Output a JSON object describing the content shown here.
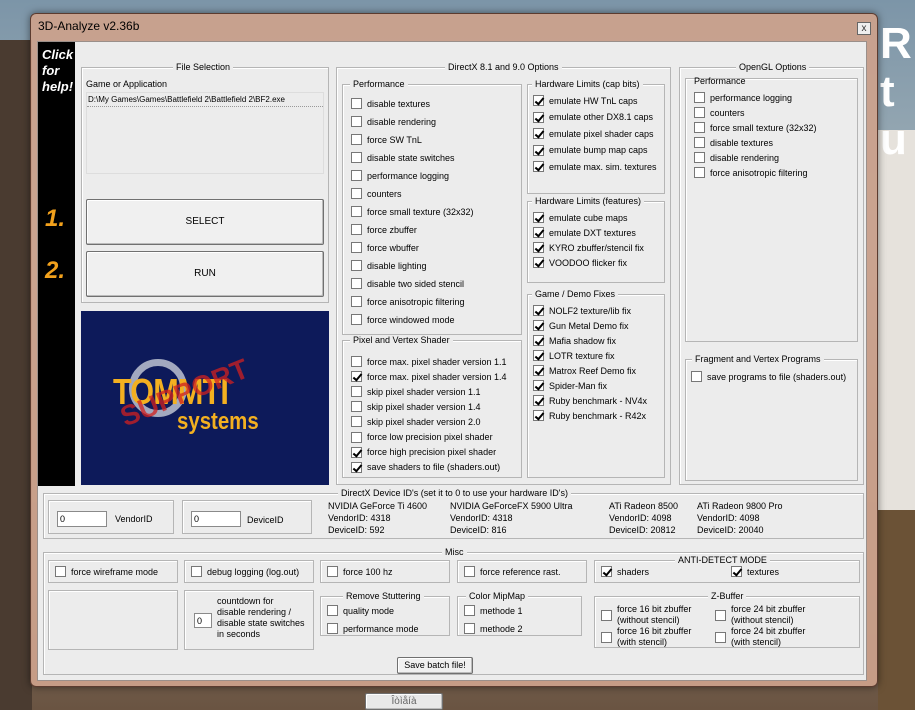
{
  "window": {
    "title": "3D-Analyze v2.36b",
    "close_glyph": "x"
  },
  "sidebar": {
    "help_lines": [
      "Click",
      "for",
      "help!"
    ],
    "step1": "1.",
    "step2": "2."
  },
  "file_selection": {
    "title": "File Selection",
    "label": "Game or Application",
    "path": "D:\\My Games\\Games\\Battlefield 2\\Battlefield 2\\BF2.exe",
    "select_label": "SELECT",
    "run_label": "RUN"
  },
  "logo": {
    "text_main": "TOMMTI",
    "text_sub": "systems",
    "stamp": "SUPPORT"
  },
  "directx": {
    "title": "DirectX 8.1 and 9.0 Options",
    "performance": {
      "title": "Performance",
      "items": [
        {
          "label": "disable textures",
          "checked": false
        },
        {
          "label": "disable rendering",
          "checked": false
        },
        {
          "label": "force SW TnL",
          "checked": false
        },
        {
          "label": "disable state switches",
          "checked": false
        },
        {
          "label": "performance logging",
          "checked": false
        },
        {
          "label": "counters",
          "checked": false
        },
        {
          "label": "force small texture (32x32)",
          "checked": false
        },
        {
          "label": "force zbuffer",
          "checked": false
        },
        {
          "label": "force wbuffer",
          "checked": false
        },
        {
          "label": "disable lighting",
          "checked": false
        },
        {
          "label": "disable two sided stencil",
          "checked": false
        },
        {
          "label": "force anisotropic filtering",
          "checked": false
        },
        {
          "label": "force windowed mode",
          "checked": false
        }
      ]
    },
    "shader": {
      "title": "Pixel and Vertex Shader",
      "items": [
        {
          "label": "force max. pixel shader version 1.1",
          "checked": false
        },
        {
          "label": "force max. pixel shader version 1.4",
          "checked": true
        },
        {
          "label": "skip pixel shader version 1.1",
          "checked": false
        },
        {
          "label": "skip pixel shader version 1.4",
          "checked": false
        },
        {
          "label": "skip pixel shader version 2.0",
          "checked": false
        },
        {
          "label": "force low precision pixel shader",
          "checked": false
        },
        {
          "label": "force high precision pixel shader",
          "checked": true
        },
        {
          "label": "save shaders to file (shaders.out)",
          "checked": true
        }
      ]
    },
    "hw_caps": {
      "title": "Hardware Limits (cap bits)",
      "items": [
        {
          "label": "emulate HW TnL caps",
          "checked": true
        },
        {
          "label": "emulate other DX8.1 caps",
          "checked": true
        },
        {
          "label": "emulate pixel shader caps",
          "checked": true
        },
        {
          "label": "emulate bump map caps",
          "checked": true
        },
        {
          "label": "emulate max. sim. textures",
          "checked": true
        }
      ]
    },
    "hw_features": {
      "title": "Hardware Limits (features)",
      "items": [
        {
          "label": "emulate cube maps",
          "checked": true
        },
        {
          "label": "emulate DXT textures",
          "checked": true
        },
        {
          "label": "KYRO zbuffer/stencil fix",
          "checked": true
        },
        {
          "label": "VOODOO flicker fix",
          "checked": true
        }
      ]
    },
    "fixes": {
      "title": "Game / Demo Fixes",
      "items": [
        {
          "label": "NOLF2 texture/lib fix",
          "checked": true
        },
        {
          "label": "Gun Metal Demo fix",
          "checked": true
        },
        {
          "label": "Mafia shadow fix",
          "checked": true
        },
        {
          "label": "LOTR texture fix",
          "checked": true
        },
        {
          "label": "Matrox Reef Demo fix",
          "checked": true
        },
        {
          "label": "Spider-Man fix",
          "checked": true
        },
        {
          "label": "Ruby benchmark - NV4x",
          "checked": true
        },
        {
          "label": "Ruby benchmark - R42x",
          "checked": true
        }
      ]
    }
  },
  "opengl": {
    "title": "OpenGL Options",
    "performance_title": "Performance",
    "items": [
      {
        "label": "performance logging",
        "checked": false
      },
      {
        "label": "counters",
        "checked": false
      },
      {
        "label": "force small texture (32x32)",
        "checked": false
      },
      {
        "label": "disable textures",
        "checked": false
      },
      {
        "label": "disable rendering",
        "checked": false
      },
      {
        "label": "force anisotropic filtering",
        "checked": false
      }
    ],
    "fragment_title": "Fragment and Vertex Programs",
    "fragment_item": {
      "label": "save programs to file (shaders.out)",
      "checked": false
    }
  },
  "device": {
    "title": "DirectX Device ID's (set it to 0 to use your hardware ID's)",
    "vendor_value": "0",
    "vendor_label": "VendorID",
    "device_value": "0",
    "device_label": "DeviceID",
    "cards": [
      {
        "name": "NVIDIA GeForce Ti 4600",
        "vendor": "VendorID: 4318",
        "device": "DeviceID: 592"
      },
      {
        "name": "NVIDIA GeForceFX 5900 Ultra",
        "vendor": "VendorID: 4318",
        "device": "DeviceID: 816"
      },
      {
        "name": "ATi Radeon 8500",
        "vendor": "VendorID: 4098",
        "device": "DeviceID: 20812"
      },
      {
        "name": "ATi Radeon 9800 Pro",
        "vendor": "VendorID: 4098",
        "device": "DeviceID: 20040"
      }
    ]
  },
  "misc": {
    "title": "Misc",
    "wireframe": {
      "label": "force wireframe mode",
      "checked": false
    },
    "debug": {
      "label": "debug logging (log.out)",
      "checked": false
    },
    "hz": {
      "label": "force 100 hz",
      "checked": false
    },
    "refrast": {
      "label": "force reference rast.",
      "checked": false
    },
    "antidetect_title": "ANTI-DETECT MODE",
    "shaders": {
      "label": "shaders",
      "checked": true
    },
    "textures": {
      "label": "textures",
      "checked": true
    },
    "countdown_value": "0",
    "countdown_lines": [
      "countdown for",
      "disable rendering /",
      "disable state switches",
      "in seconds"
    ],
    "stutter_title": "Remove Stuttering",
    "quality": {
      "label": "quality mode",
      "checked": false
    },
    "perf_mode": {
      "label": "performance mode",
      "checked": false
    },
    "mipmap_title": "Color MipMap",
    "methode1": {
      "label": "methode 1",
      "checked": false
    },
    "methode2": {
      "label": "methode 2",
      "checked": false
    },
    "zbuffer_title": "Z-Buffer",
    "z16a": {
      "lines": [
        "force 16 bit zbuffer",
        "(without stencil)"
      ],
      "checked": false
    },
    "z24a": {
      "lines": [
        "force 24 bit zbuffer",
        "(without stencil)"
      ],
      "checked": false
    },
    "z16b": {
      "lines": [
        "force 16 bit zbuffer",
        "(with stencil)"
      ],
      "checked": false
    },
    "z24b": {
      "lines": [
        "force 24 bit zbuffer",
        "(with stencil)"
      ],
      "checked": false
    },
    "save_batch": "Save batch file!"
  },
  "background_button": "Îòìåíà"
}
